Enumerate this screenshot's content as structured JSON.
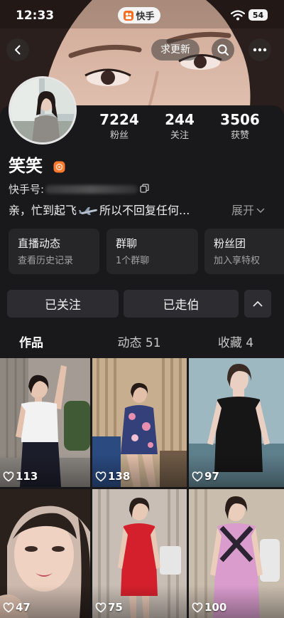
{
  "status_bar": {
    "time": "12:33",
    "app_name": "快手",
    "battery": "54"
  },
  "top_bar": {
    "update_request": "求更新"
  },
  "profile": {
    "name": "笑笑",
    "id_label": "快手号:",
    "bio_start": "亲，忙到起飞",
    "bio_end": "所以不回复任何...",
    "expand": "展开"
  },
  "stats": [
    {
      "value": "7224",
      "label": "粉丝"
    },
    {
      "value": "244",
      "label": "关注"
    },
    {
      "value": "3506",
      "label": "获赞"
    }
  ],
  "cards": [
    {
      "title": "直播动态",
      "subtitle": "查看历史记录"
    },
    {
      "title": "群聊",
      "subtitle": "1个群聊"
    },
    {
      "title": "粉丝团",
      "subtitle": "加入享特权"
    }
  ],
  "actions": {
    "follow": "已关注",
    "secondary": "已走伯"
  },
  "tabs": [
    {
      "label": "作品",
      "active": true
    },
    {
      "label": "动态 51",
      "active": false
    },
    {
      "label": "收藏 4",
      "active": false
    }
  ],
  "videos": [
    {
      "likes": "113"
    },
    {
      "likes": "138"
    },
    {
      "likes": "97"
    },
    {
      "likes": "47"
    },
    {
      "likes": "75"
    },
    {
      "likes": "100"
    }
  ],
  "icons": {
    "back": "back-icon",
    "search": "search-icon",
    "more": "more-icon",
    "wifi": "wifi-icon",
    "copy": "copy-icon",
    "badge": "verified-badge-icon",
    "plane": "airplane-icon",
    "expand": "chevron-down-icon",
    "collapse": "chevron-up-icon",
    "like": "heart-icon"
  },
  "colors": {
    "background": "#19181a",
    "card": "#262629",
    "button": "#2d2d31",
    "accent": "#ff7a2e",
    "text_muted": "#a3a3a3"
  }
}
